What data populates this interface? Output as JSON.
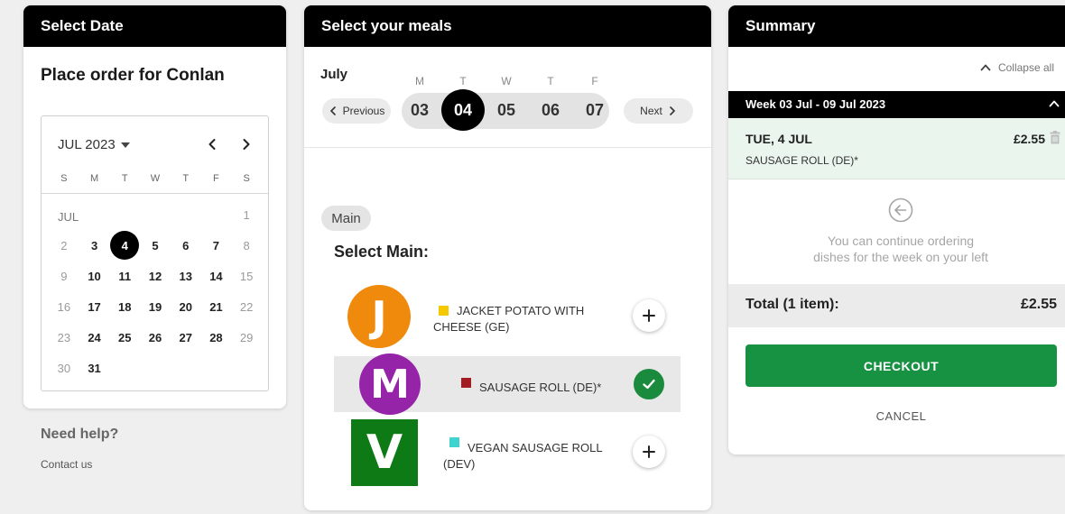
{
  "left_panel": {
    "header": "Select Date",
    "title": "Place order for Conlan",
    "calendar": {
      "month_label": "JUL 2023",
      "weekdays": [
        "S",
        "M",
        "T",
        "W",
        "T",
        "F",
        "S"
      ],
      "section_label": "JUL",
      "first_row": [
        "",
        "",
        "",
        "",
        "",
        "",
        "1"
      ],
      "rows": [
        [
          "2",
          "3",
          "4",
          "5",
          "6",
          "7",
          "8"
        ],
        [
          "9",
          "10",
          "11",
          "12",
          "13",
          "14",
          "15"
        ],
        [
          "16",
          "17",
          "18",
          "19",
          "20",
          "21",
          "22"
        ],
        [
          "23",
          "24",
          "25",
          "26",
          "27",
          "28",
          "29"
        ],
        [
          "30",
          "31",
          "",
          "",
          "",
          "",
          ""
        ]
      ],
      "selected_day": "4"
    },
    "help_title": "Need help?",
    "contact_link": "Contact us"
  },
  "mid_panel": {
    "header": "Select your meals",
    "month": "July",
    "day_initials": [
      "M",
      "T",
      "W",
      "T",
      "F"
    ],
    "days": [
      "03",
      "04",
      "05",
      "06",
      "07"
    ],
    "active_day": "04",
    "prev_label": "Previous",
    "next_label": "Next",
    "tab_label": "Main",
    "section_title": "Select Main:",
    "meals": [
      {
        "letter": "J",
        "badge_color": "#f08a0c",
        "swatch_color": "#f5c800",
        "name_line1": "JACKET POTATO WITH",
        "name_line2": "CHEESE (GE)",
        "selected": false
      },
      {
        "letter": "M",
        "badge_color": "#9524a8",
        "swatch_color": "#a31c24",
        "name_line1": "SAUSAGE ROLL (DE)*",
        "name_line2": "",
        "selected": true
      },
      {
        "letter": "V",
        "badge_color": "#0e7a16",
        "swatch_color": "#3fd4cf",
        "name_line1": "VEGAN SAUSAGE ROLL",
        "name_line2": "(DEV)",
        "selected": false
      }
    ]
  },
  "right_panel": {
    "header": "Summary",
    "collapse_label": "Collapse all",
    "week_label": "Week 03 Jul - 09 Jul 2023",
    "order": {
      "day": "TUE, 4 JUL",
      "price": "£2.55",
      "item": "SAUSAGE ROLL (DE)*"
    },
    "continue_line1": "You can continue ordering",
    "continue_line2": "dishes for the week on your left",
    "total_label": "Total (1 item):",
    "total_value": "£2.55",
    "checkout_label": "CHECKOUT",
    "cancel_label": "CANCEL"
  },
  "colors": {
    "accent_green": "#179142",
    "header_black": "#000000",
    "selected_item_bg": "#eaf6ed"
  }
}
